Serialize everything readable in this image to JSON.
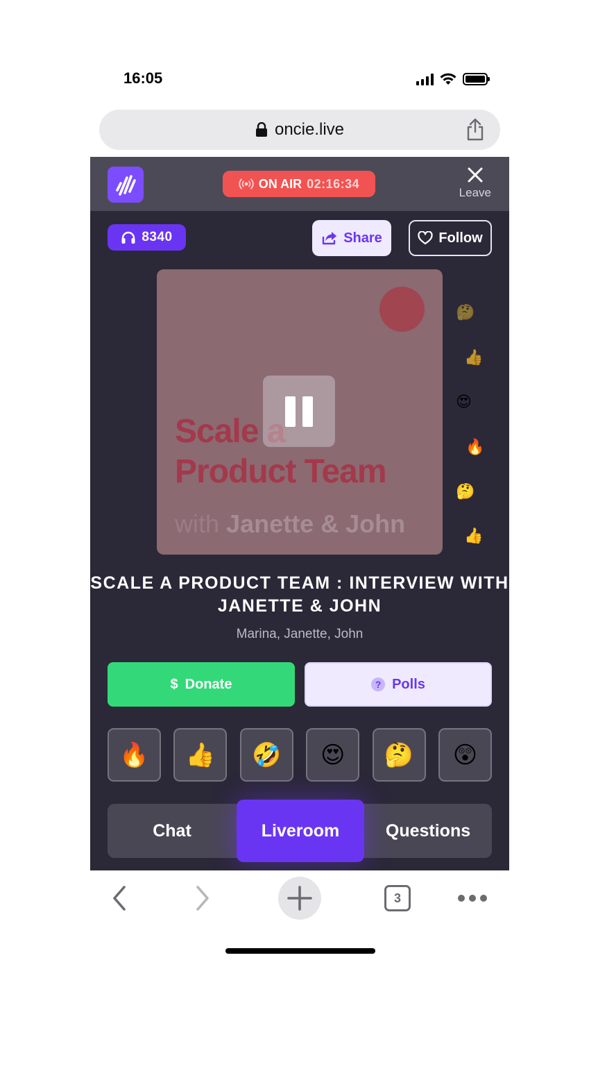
{
  "status_bar": {
    "time": "16:05"
  },
  "browser": {
    "url": "oncie.live",
    "open_tabs": "3"
  },
  "header": {
    "on_air_label": "ON AIR",
    "on_air_time": "02:16:34",
    "leave_label": "Leave"
  },
  "actions": {
    "listeners": "8340",
    "share_label": "Share",
    "follow_label": "Follow"
  },
  "cover": {
    "title_line1": "Scale a",
    "title_line2": "Product Team",
    "subtitle_prefix": "with",
    "subtitle_names": "Janette & John"
  },
  "floating_reactions": [
    "🤔",
    "👍",
    "😍",
    "🔥",
    "🤔",
    "👍"
  ],
  "show": {
    "title": "SCALE A PRODUCT TEAM : INTERVIEW WITH JANETTE & JOHN",
    "hosts": "Marina, Janette, John"
  },
  "buttons": {
    "donate_label": "Donate",
    "polls_label": "Polls"
  },
  "reactions": [
    "🔥",
    "👍",
    "🤣",
    "😍",
    "🤔",
    "😲"
  ],
  "tabs": [
    {
      "label": "Chat",
      "active": false
    },
    {
      "label": "Liveroom",
      "active": true
    },
    {
      "label": "Questions",
      "active": false
    }
  ],
  "colors": {
    "accent": "#6a35f2",
    "on_air": "#f15352",
    "donate": "#33d979",
    "app_bg": "#2b2838"
  }
}
